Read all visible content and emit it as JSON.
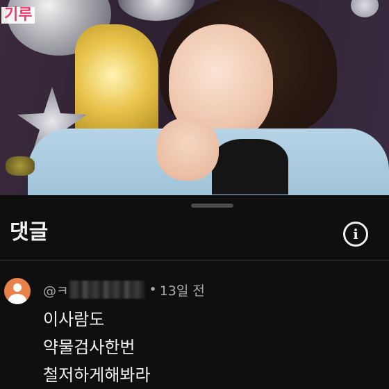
{
  "video": {
    "caption_fragment": "기루"
  },
  "comments_panel": {
    "title": "댓글",
    "info_icon": "info-circle-icon"
  },
  "comment": {
    "author_prefix": "@ㅋ",
    "time_ago": "13일 전",
    "separator": "•",
    "lines": [
      "이사람도",
      "약물검사한번",
      "철저하게해봐라"
    ],
    "avatar_color": "#e8824a"
  }
}
